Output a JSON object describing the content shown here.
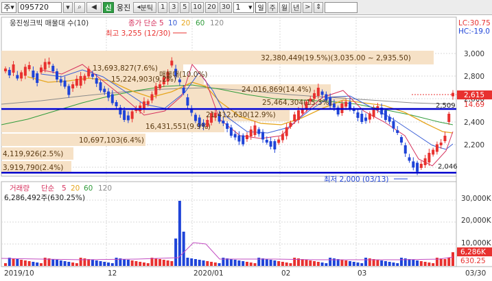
{
  "toolbar": {
    "market_label": "주",
    "code": "095720",
    "stock_name": "웅진",
    "credit_badge": "신",
    "period_label": "분",
    "tick_label": "틱",
    "intervals": [
      "1",
      "3",
      "5",
      "10",
      "20",
      "30"
    ],
    "count_value": "1",
    "day_label": "일",
    "week_label": "주",
    "month_label": "월",
    "year_label": "년"
  },
  "price_panel": {
    "title": "웅진씽크빅 매물대 수(10)",
    "ma_label": "종가 단순",
    "ma_periods": [
      "5",
      "10",
      "20",
      "60",
      "120"
    ],
    "max_label": "최고 3,255 (12/30)",
    "min_label": "최저 2,000 (03/13)",
    "lc_label": "LC:30.75",
    "hc_label": "HC:-19.0",
    "current_price": "2,615",
    "current_change": "14.69",
    "line_upper_label": "2,509",
    "line_lower_label": "2,046",
    "y_ticks": [
      "3,000",
      "2,800",
      "2,600",
      "2,400",
      "2,200"
    ],
    "volume_profile": [
      {
        "label": "32,380,449(19.5%)(3,035.00 ~ 2,935.50)"
      },
      {
        "label": "13,693,827(7.6%)"
      },
      {
        "label": "15,224,903(9.2%)"
      },
      {
        "label": "매물대(10.0%)"
      },
      {
        "label": "24,016,869(14.4%)"
      },
      {
        "label": "25,464,304(15.3%)"
      },
      {
        "label": "21,412,630(12.9%)"
      },
      {
        "label": "16,431,551(9.9%)"
      },
      {
        "label": "10,697,103(6.4%)"
      },
      {
        "label": "4,119,926(2.5%)"
      },
      {
        "label": "3,919,790(2.4%)"
      }
    ]
  },
  "volume_panel": {
    "title": "거래량",
    "ma_label": "단순",
    "ma_periods": [
      "5",
      "20",
      "60",
      "120"
    ],
    "current_volume": "6,286,492주(630.25%)",
    "y_ticks": [
      "30,000K",
      "20,000K",
      "10,000K"
    ],
    "last_value": "6,286K",
    "last_pct": "630.25"
  },
  "x_axis": {
    "labels": [
      "2019/10",
      "12",
      "2020/01",
      "02",
      "03",
      "03/30"
    ]
  },
  "colors": {
    "up": "#e8312f",
    "down": "#1f44d8",
    "ma5": "#d6315d",
    "ma10": "#3b5fd6",
    "ma20": "#e6a51c",
    "ma60": "#2f9b3a",
    "ma120": "#8a8a8a",
    "profile": "#f6e1c6",
    "hline": "#0000cc"
  }
}
